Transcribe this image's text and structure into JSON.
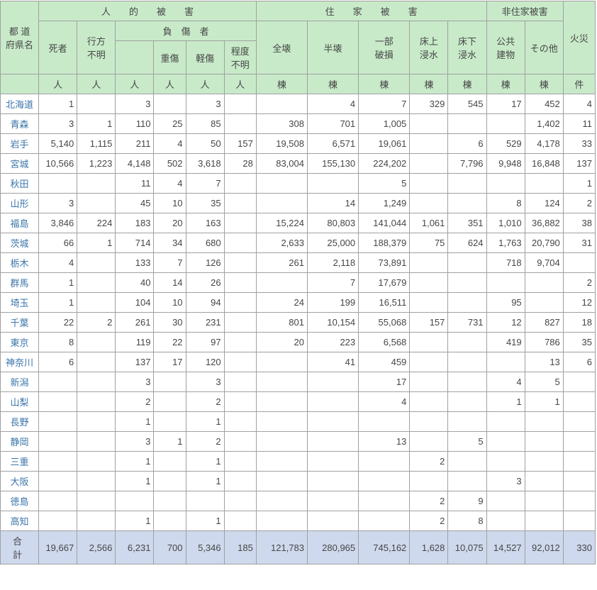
{
  "headers": {
    "pref": "都 道\n府県名",
    "human_group": "人　　的　　被　　害",
    "house_group": "住　　家　　被　　害",
    "nonhouse_group": "非住家被害",
    "fire": "火災",
    "dead": "死者",
    "missing": "行方\n不明",
    "injured": "負　傷　者",
    "serious": "重傷",
    "light": "軽傷",
    "unknown": "程度\n不明",
    "full": "全壊",
    "half": "半壊",
    "partial": "一部\n破損",
    "abovefl": "床上\n浸水",
    "belowfl": "床下\n浸水",
    "public": "公共\n建物",
    "other": "その他",
    "unit_person": "人",
    "unit_build": "棟",
    "unit_case": "件",
    "total_label": "合　計"
  },
  "rows": [
    {
      "pref": "北海道",
      "dead": "1",
      "missing": "",
      "injured": "3",
      "serious": "",
      "light": "3",
      "unknown": "",
      "full": "",
      "half": "4",
      "partial": "7",
      "abovefl": "329",
      "belowfl": "545",
      "public": "17",
      "other": "452",
      "fire": "4"
    },
    {
      "pref": "青森",
      "dead": "3",
      "missing": "1",
      "injured": "110",
      "serious": "25",
      "light": "85",
      "unknown": "",
      "full": "308",
      "half": "701",
      "partial": "1,005",
      "abovefl": "",
      "belowfl": "",
      "public": "",
      "other": "1,402",
      "fire": "11"
    },
    {
      "pref": "岩手",
      "dead": "5,140",
      "missing": "1,115",
      "injured": "211",
      "serious": "4",
      "light": "50",
      "unknown": "157",
      "full": "19,508",
      "half": "6,571",
      "partial": "19,061",
      "abovefl": "",
      "belowfl": "6",
      "public": "529",
      "other": "4,178",
      "fire": "33"
    },
    {
      "pref": "宮城",
      "dead": "10,566",
      "missing": "1,223",
      "injured": "4,148",
      "serious": "502",
      "light": "3,618",
      "unknown": "28",
      "full": "83,004",
      "half": "155,130",
      "partial": "224,202",
      "abovefl": "",
      "belowfl": "7,796",
      "public": "9,948",
      "other": "16,848",
      "fire": "137"
    },
    {
      "pref": "秋田",
      "dead": "",
      "missing": "",
      "injured": "11",
      "serious": "4",
      "light": "7",
      "unknown": "",
      "full": "",
      "half": "",
      "partial": "5",
      "abovefl": "",
      "belowfl": "",
      "public": "",
      "other": "",
      "fire": "1"
    },
    {
      "pref": "山形",
      "dead": "3",
      "missing": "",
      "injured": "45",
      "serious": "10",
      "light": "35",
      "unknown": "",
      "full": "",
      "half": "14",
      "partial": "1,249",
      "abovefl": "",
      "belowfl": "",
      "public": "8",
      "other": "124",
      "fire": "2"
    },
    {
      "pref": "福島",
      "dead": "3,846",
      "missing": "224",
      "injured": "183",
      "serious": "20",
      "light": "163",
      "unknown": "",
      "full": "15,224",
      "half": "80,803",
      "partial": "141,044",
      "abovefl": "1,061",
      "belowfl": "351",
      "public": "1,010",
      "other": "36,882",
      "fire": "38"
    },
    {
      "pref": "茨城",
      "dead": "66",
      "missing": "1",
      "injured": "714",
      "serious": "34",
      "light": "680",
      "unknown": "",
      "full": "2,633",
      "half": "25,000",
      "partial": "188,379",
      "abovefl": "75",
      "belowfl": "624",
      "public": "1,763",
      "other": "20,790",
      "fire": "31"
    },
    {
      "pref": "栃木",
      "dead": "4",
      "missing": "",
      "injured": "133",
      "serious": "7",
      "light": "126",
      "unknown": "",
      "full": "261",
      "half": "2,118",
      "partial": "73,891",
      "abovefl": "",
      "belowfl": "",
      "public": "718",
      "other": "9,704",
      "fire": ""
    },
    {
      "pref": "群馬",
      "dead": "1",
      "missing": "",
      "injured": "40",
      "serious": "14",
      "light": "26",
      "unknown": "",
      "full": "",
      "half": "7",
      "partial": "17,679",
      "abovefl": "",
      "belowfl": "",
      "public": "",
      "other": "",
      "fire": "2"
    },
    {
      "pref": "埼玉",
      "dead": "1",
      "missing": "",
      "injured": "104",
      "serious": "10",
      "light": "94",
      "unknown": "",
      "full": "24",
      "half": "199",
      "partial": "16,511",
      "abovefl": "",
      "belowfl": "",
      "public": "95",
      "other": "",
      "fire": "12"
    },
    {
      "pref": "千葉",
      "dead": "22",
      "missing": "2",
      "injured": "261",
      "serious": "30",
      "light": "231",
      "unknown": "",
      "full": "801",
      "half": "10,154",
      "partial": "55,068",
      "abovefl": "157",
      "belowfl": "731",
      "public": "12",
      "other": "827",
      "fire": "18"
    },
    {
      "pref": "東京",
      "dead": "8",
      "missing": "",
      "injured": "119",
      "serious": "22",
      "light": "97",
      "unknown": "",
      "full": "20",
      "half": "223",
      "partial": "6,568",
      "abovefl": "",
      "belowfl": "",
      "public": "419",
      "other": "786",
      "fire": "35"
    },
    {
      "pref": "神奈川",
      "dead": "6",
      "missing": "",
      "injured": "137",
      "serious": "17",
      "light": "120",
      "unknown": "",
      "full": "",
      "half": "41",
      "partial": "459",
      "abovefl": "",
      "belowfl": "",
      "public": "",
      "other": "13",
      "fire": "6"
    },
    {
      "pref": "新潟",
      "dead": "",
      "missing": "",
      "injured": "3",
      "serious": "",
      "light": "3",
      "unknown": "",
      "full": "",
      "half": "",
      "partial": "17",
      "abovefl": "",
      "belowfl": "",
      "public": "4",
      "other": "5",
      "fire": ""
    },
    {
      "pref": "山梨",
      "dead": "",
      "missing": "",
      "injured": "2",
      "serious": "",
      "light": "2",
      "unknown": "",
      "full": "",
      "half": "",
      "partial": "4",
      "abovefl": "",
      "belowfl": "",
      "public": "1",
      "other": "1",
      "fire": ""
    },
    {
      "pref": "長野",
      "dead": "",
      "missing": "",
      "injured": "1",
      "serious": "",
      "light": "1",
      "unknown": "",
      "full": "",
      "half": "",
      "partial": "",
      "abovefl": "",
      "belowfl": "",
      "public": "",
      "other": "",
      "fire": ""
    },
    {
      "pref": "静岡",
      "dead": "",
      "missing": "",
      "injured": "3",
      "serious": "1",
      "light": "2",
      "unknown": "",
      "full": "",
      "half": "",
      "partial": "13",
      "abovefl": "",
      "belowfl": "5",
      "public": "",
      "other": "",
      "fire": ""
    },
    {
      "pref": "三重",
      "dead": "",
      "missing": "",
      "injured": "1",
      "serious": "",
      "light": "1",
      "unknown": "",
      "full": "",
      "half": "",
      "partial": "",
      "abovefl": "2",
      "belowfl": "",
      "public": "",
      "other": "",
      "fire": ""
    },
    {
      "pref": "大阪",
      "dead": "",
      "missing": "",
      "injured": "1",
      "serious": "",
      "light": "1",
      "unknown": "",
      "full": "",
      "half": "",
      "partial": "",
      "abovefl": "",
      "belowfl": "",
      "public": "3",
      "other": "",
      "fire": ""
    },
    {
      "pref": "徳島",
      "dead": "",
      "missing": "",
      "injured": "",
      "serious": "",
      "light": "",
      "unknown": "",
      "full": "",
      "half": "",
      "partial": "",
      "abovefl": "2",
      "belowfl": "9",
      "public": "",
      "other": "",
      "fire": ""
    },
    {
      "pref": "高知",
      "dead": "",
      "missing": "",
      "injured": "1",
      "serious": "",
      "light": "1",
      "unknown": "",
      "full": "",
      "half": "",
      "partial": "",
      "abovefl": "2",
      "belowfl": "8",
      "public": "",
      "other": "",
      "fire": ""
    }
  ],
  "total": {
    "pref": "合　計",
    "dead": "19,667",
    "missing": "2,566",
    "injured": "6,231",
    "serious": "700",
    "light": "5,346",
    "unknown": "185",
    "full": "121,783",
    "half": "280,965",
    "partial": "745,162",
    "abovefl": "1,628",
    "belowfl": "10,075",
    "public": "14,527",
    "other": "92,012",
    "fire": "330"
  }
}
